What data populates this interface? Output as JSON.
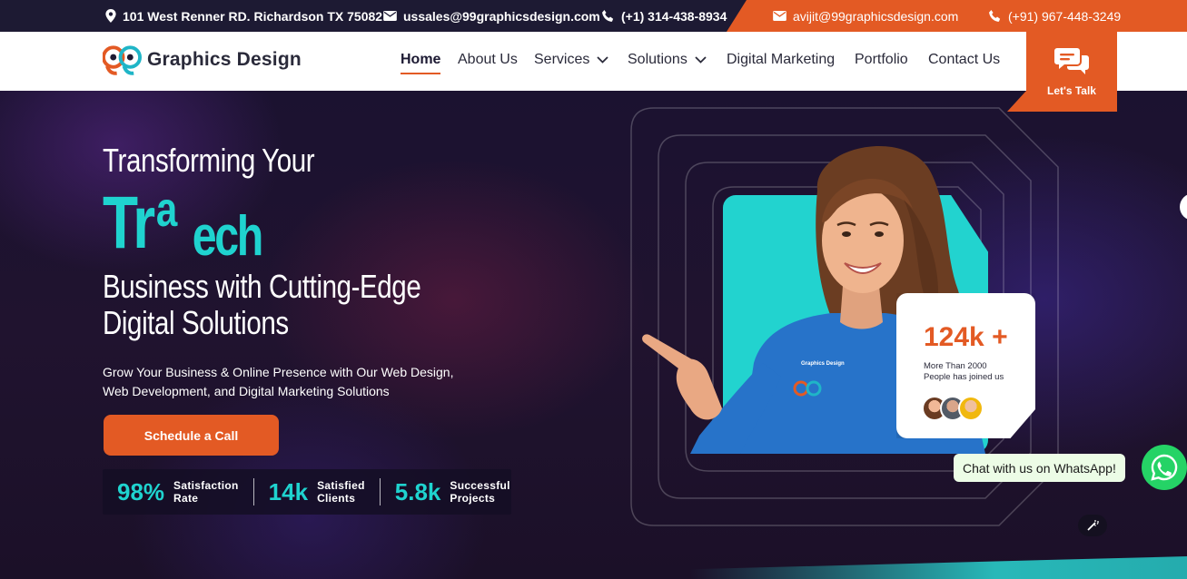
{
  "topbar": {
    "address": "101 West Renner RD. Richardson TX 75082",
    "email_us": "ussales@99graphicsdesign.com",
    "phone_us": "(+1) 314-438-8934",
    "email_in": "avijit@99graphicsdesign.com",
    "phone_in": "(+91) 967-448-3249",
    "icons": [
      "location-pin-icon",
      "mail-icon",
      "phone-icon"
    ]
  },
  "header": {
    "logo_text": "Graphics Design",
    "nav": [
      {
        "label": "Home",
        "active": true
      },
      {
        "label": "About Us"
      },
      {
        "label": "Services",
        "dropdown": true
      },
      {
        "label": "Solutions",
        "dropdown": true
      },
      {
        "label": "Digital Marketing"
      },
      {
        "label": "Portfolio"
      },
      {
        "label": "Contact Us"
      }
    ],
    "lets_talk": "Let's Talk"
  },
  "hero": {
    "line1": "Transforming Your",
    "animated_parts": [
      "Tr",
      "a",
      "ech"
    ],
    "line3a": "Business with Cutting-Edge",
    "line3b": "Digital Solutions",
    "subtitle_a": "Grow Your Business & Online Presence with Our Web Design,",
    "subtitle_b": "Web Development, and Digital Marketing Solutions",
    "cta": "Schedule a Call",
    "stats": [
      {
        "value": "98%",
        "label_a": "Satisfaction",
        "label_b": "Rate"
      },
      {
        "value": "14k",
        "label_a": "Satisfied",
        "label_b": "Clients"
      },
      {
        "value": "5.8k",
        "label_a": "Successful",
        "label_b": "Projects"
      }
    ],
    "card": {
      "number": "124k +",
      "text_a": "More Than 2000",
      "text_b": "People has joined us"
    },
    "shirt_text": "Graphics Design"
  },
  "widgets": {
    "whatsapp_label": "Chat with us on WhatsApp!"
  },
  "colors": {
    "accent": "#e35a24",
    "teal": "#1fd3cf",
    "navy": "#1d1a33",
    "whatsapp": "#25d366"
  }
}
